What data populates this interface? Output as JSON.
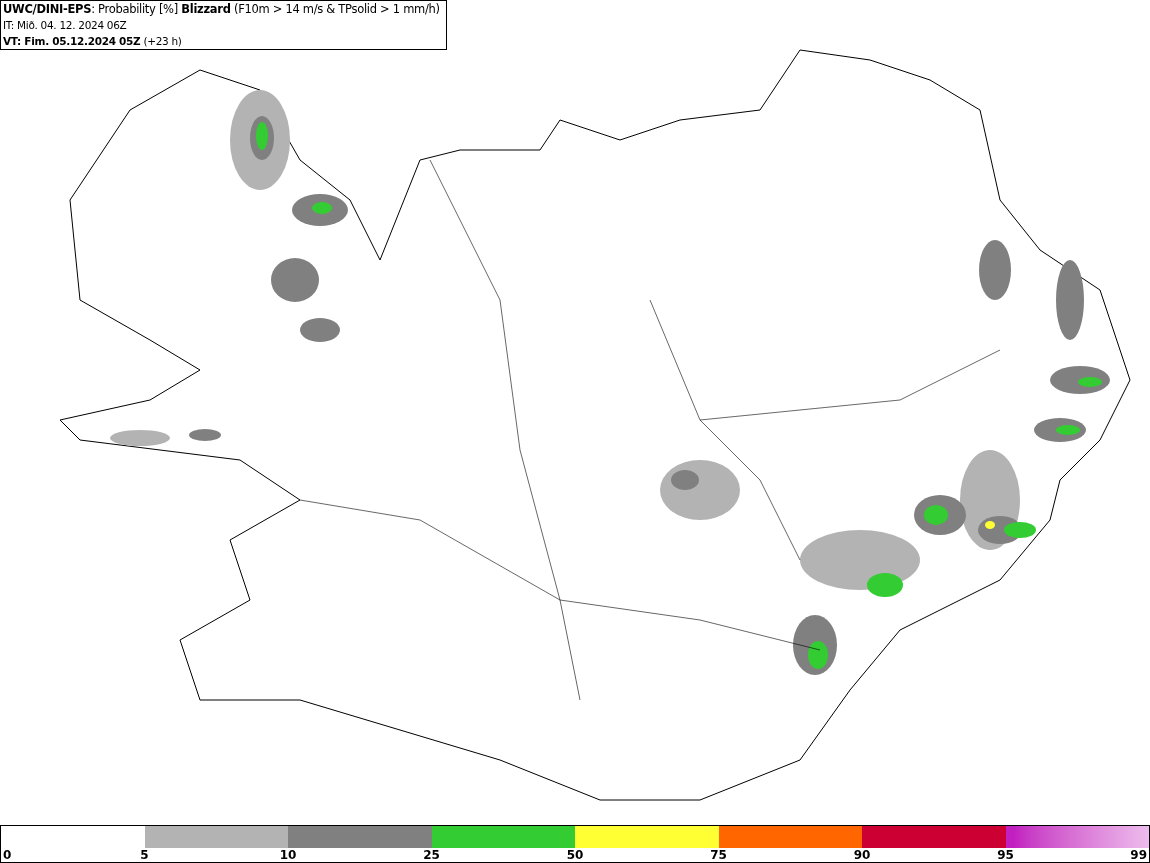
{
  "header": {
    "lines": [
      "**UWC/DINI-EPS**: Probability [%] **Blizzard** (F10m > 14 m/s & TPsolid > 1 mm/h)",
      "IT: Mið. 04. 12. 2024 06Z",
      "**VT: Fim. 05.12.2024 05Z** (+23 h)"
    ]
  },
  "legend": {
    "segments": [
      {
        "color": "#b3b3b3"
      },
      {
        "color": "#808080"
      },
      {
        "color": "#33cc33"
      },
      {
        "color": "#ffff33"
      },
      {
        "color": "#ff6600"
      },
      {
        "color": "#cc0033"
      },
      {
        "color": "#c21fc0",
        "kind": "gradient"
      }
    ],
    "ticks": [
      "0",
      "5",
      "10",
      "25",
      "50",
      "75",
      "90",
      "95",
      "99"
    ]
  }
}
